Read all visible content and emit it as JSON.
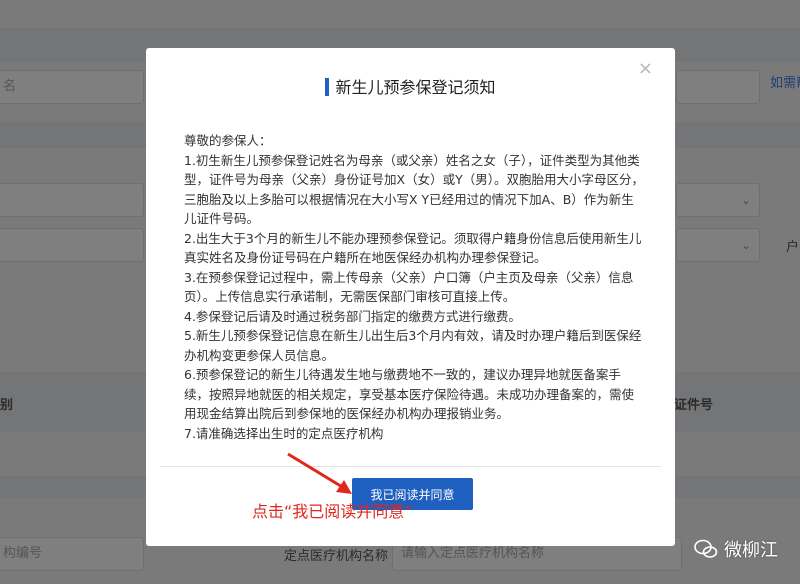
{
  "background": {
    "top_right_link": "如需帮",
    "field_left_text": "名",
    "field_right_label": "户",
    "col_header_left": "别",
    "col_header_right": "证件号",
    "bottom_field_placeholder": "构编号",
    "bottom_label": "定点医疗机构名称",
    "bottom_input_placeholder": "请输入定点医疗机构名称"
  },
  "modal": {
    "title": "新生儿预参保登记须知",
    "close_symbol": "×",
    "body": [
      "尊敬的参保人：",
      "1.初生新生儿预参保登记姓名为母亲（或父亲）姓名之女（子），证件类型为其他类型，证件号为母亲（父亲）身份证号加X（女）或Y（男）。双胞胎用大小字母区分，三胞胎及以上多胎可以根据情况在大小写X Y已经用过的情况下加A、B）作为新生儿证件号码。",
      "2.出生大于3个月的新生儿不能办理预参保登记。须取得户籍身份信息后使用新生儿真实姓名及身份证号码在户籍所在地医保经办机构办理参保登记。",
      "3.在预参保登记过程中，需上传母亲（父亲）户口簿（户主页及母亲（父亲）信息页）。上传信息实行承诺制，无需医保部门审核可直接上传。",
      "4.参保登记后请及时通过税务部门指定的缴费方式进行缴费。",
      "5.新生儿预参保登记信息在新生儿出生后3个月内有效，请及时办理户籍后到医保经办机构变更参保人员信息。",
      "6.预参保登记的新生儿待遇发生地与缴费地不一致的，建议办理异地就医备案手续，按照异地就医的相关规定，享受基本医疗保险待遇。未成功办理备案的，需使用现金结算出院后到参保地的医保经办机构办理报销业务。",
      "7.请准确选择出生时的定点医疗机构"
    ],
    "agree_button": "我已阅读并同意"
  },
  "annotation": "点击“我已阅读并同意”",
  "watermark": "微柳江",
  "colors": {
    "accent": "#1f5fbf",
    "annotation": "#e0261d"
  }
}
